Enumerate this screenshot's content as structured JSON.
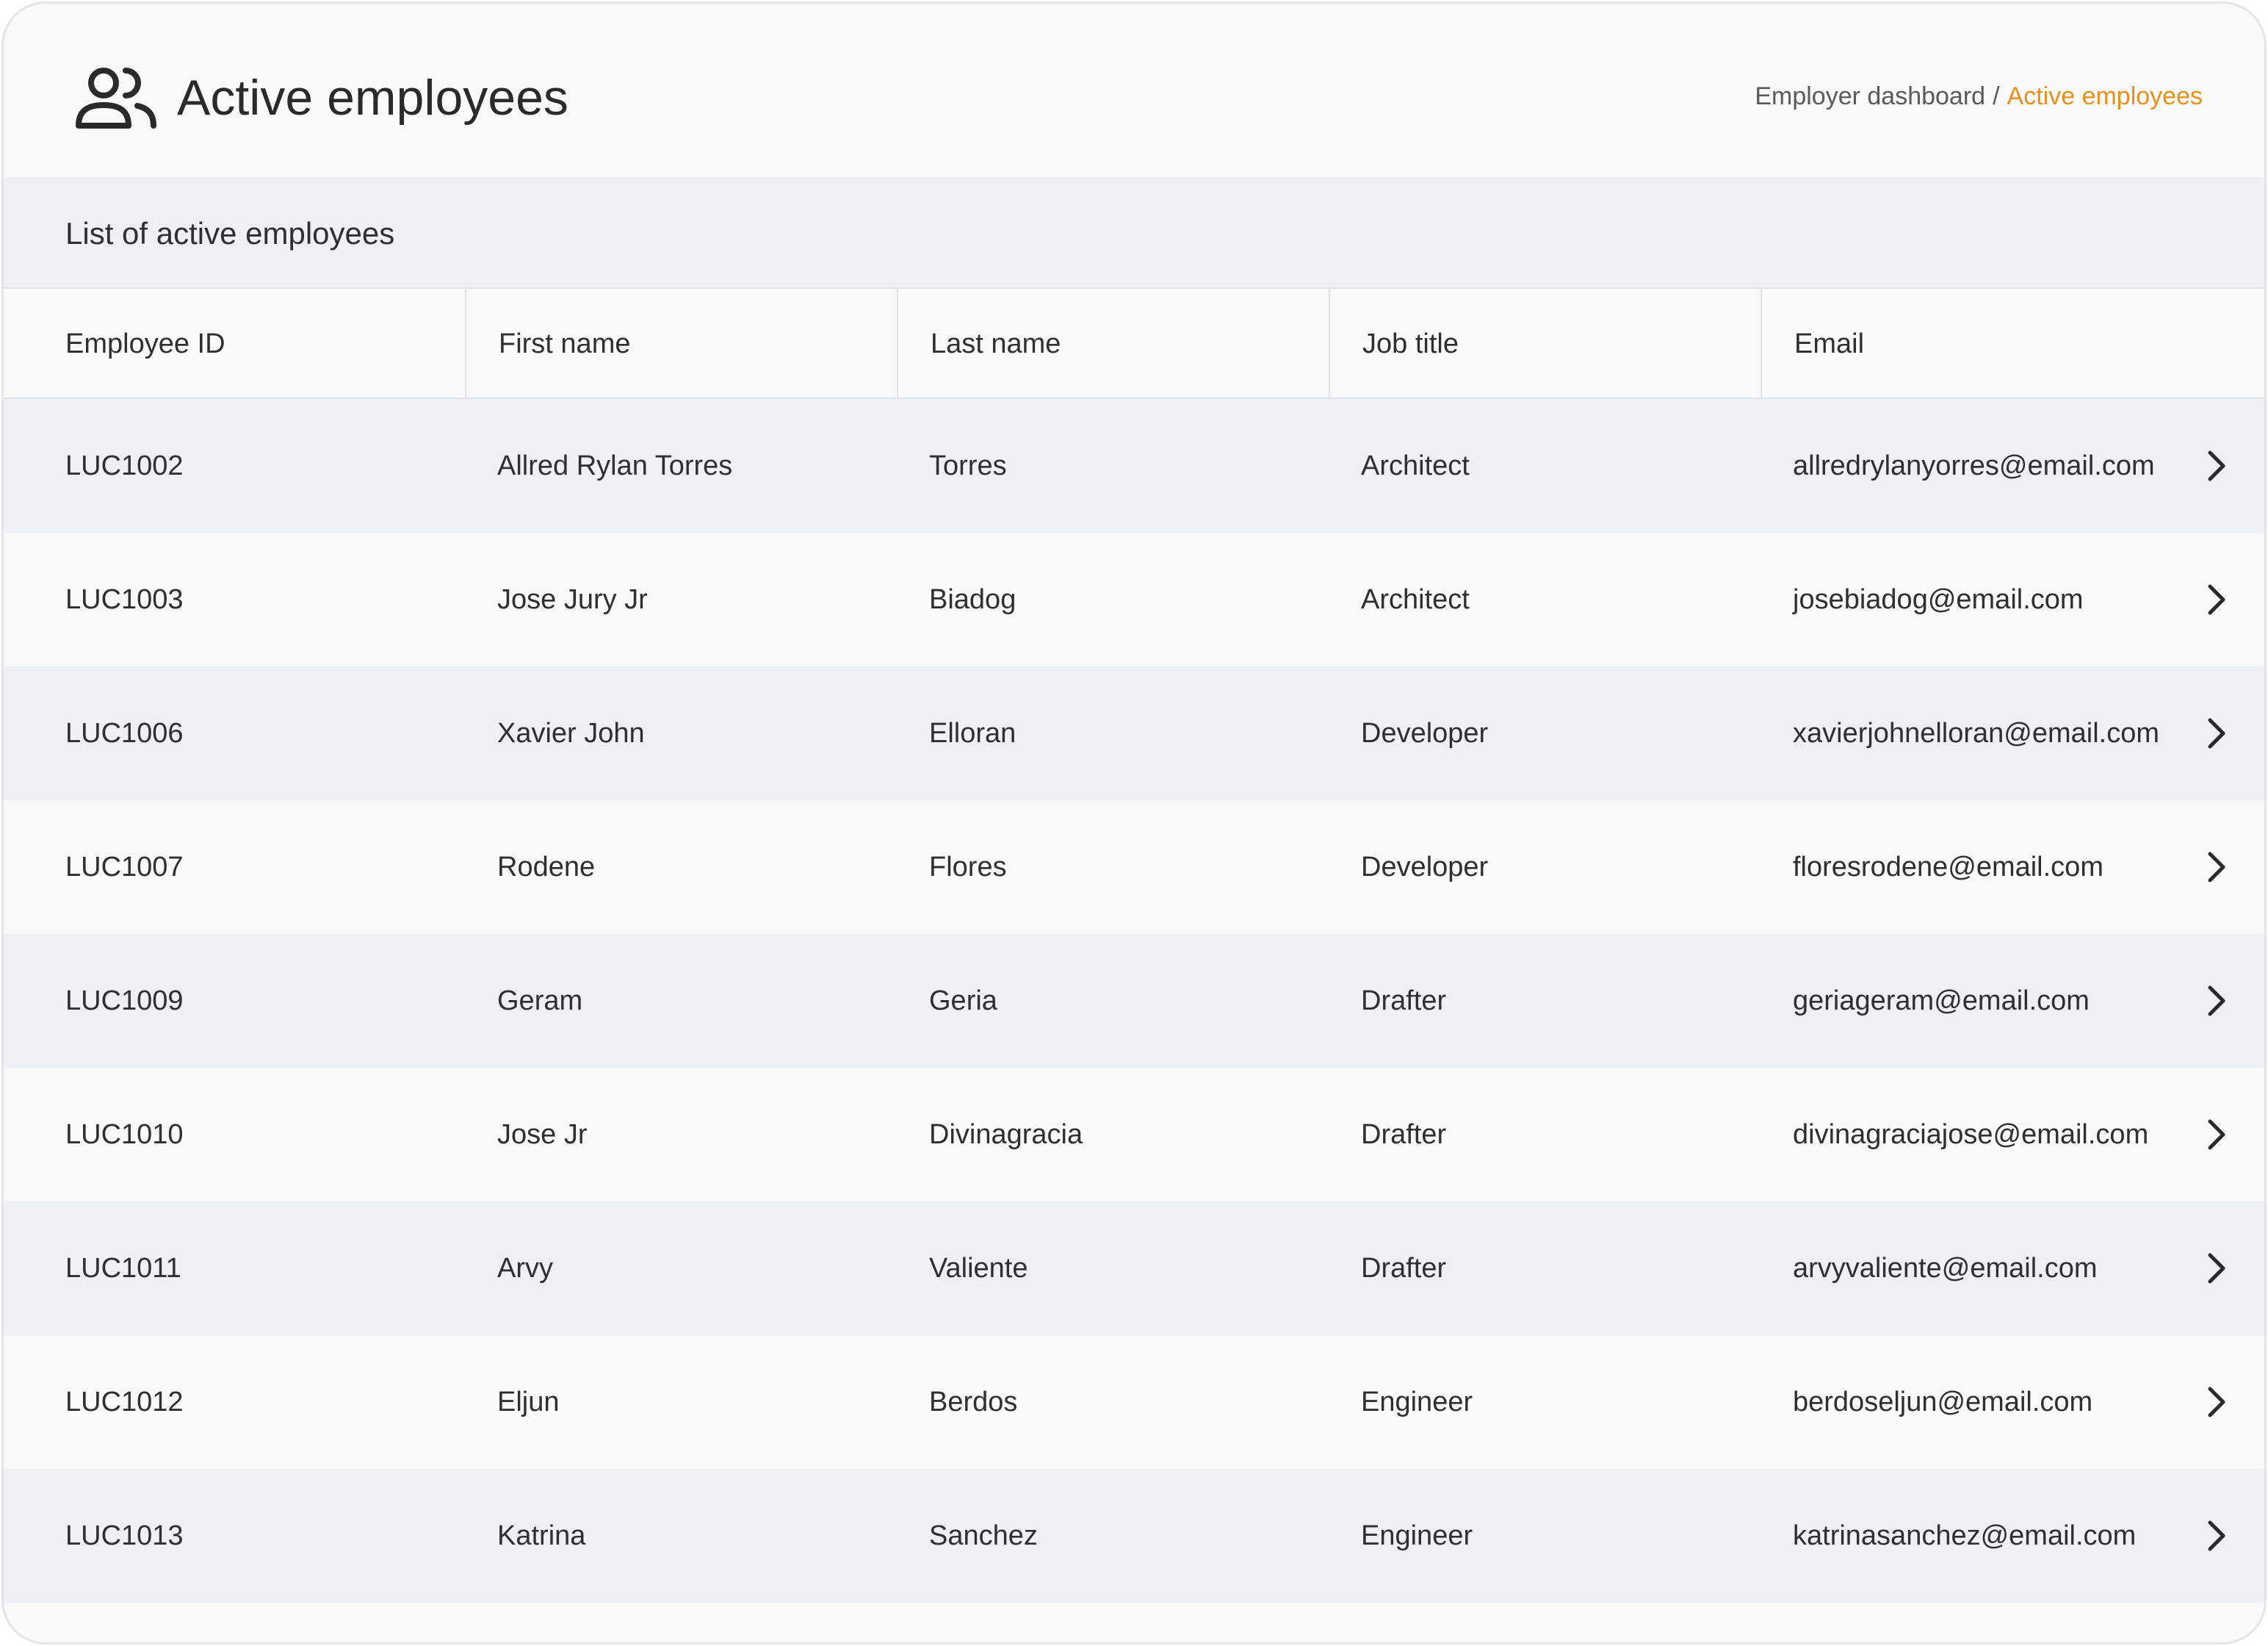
{
  "header": {
    "title": "Active employees",
    "icon": "users-icon",
    "breadcrumb": {
      "parent": "Employer dashboard",
      "separator": "/",
      "current": "Active employees"
    }
  },
  "section": {
    "title": "List of active employees"
  },
  "table": {
    "columns": [
      "Employee ID",
      "First name",
      "Last name",
      "Job title",
      "Email"
    ],
    "rows": [
      {
        "id": "LUC1002",
        "first": "Allred Rylan Torres",
        "last": "Torres",
        "job": "Architect",
        "email": "allredrylanyorres@email.com"
      },
      {
        "id": "LUC1003",
        "first": "Jose Jury Jr",
        "last": "Biadog",
        "job": "Architect",
        "email": "josebiadog@email.com"
      },
      {
        "id": "LUC1006",
        "first": "Xavier John",
        "last": "Elloran",
        "job": "Developer",
        "email": "xavierjohnelloran@email.com"
      },
      {
        "id": "LUC1007",
        "first": "Rodene",
        "last": "Flores",
        "job": "Developer",
        "email": "floresrodene@email.com"
      },
      {
        "id": "LUC1009",
        "first": "Geram",
        "last": "Geria",
        "job": "Drafter",
        "email": "geriageram@email.com"
      },
      {
        "id": "LUC1010",
        "first": "Jose Jr",
        "last": "Divinagracia",
        "job": "Drafter",
        "email": "divinagraciajose@email.com"
      },
      {
        "id": "LUC1011",
        "first": "Arvy",
        "last": "Valiente",
        "job": "Drafter",
        "email": "arvyvaliente@email.com"
      },
      {
        "id": "LUC1012",
        "first": "Eljun",
        "last": "Berdos",
        "job": "Engineer",
        "email": "berdoseljun@email.com"
      },
      {
        "id": "LUC1013",
        "first": "Katrina",
        "last": "Sanchez",
        "job": "Engineer",
        "email": "katrinasanchez@email.com"
      }
    ]
  },
  "colors": {
    "accent": "#e8901e",
    "row_alt": "#eef1f3",
    "background": "#f9f9f9"
  }
}
